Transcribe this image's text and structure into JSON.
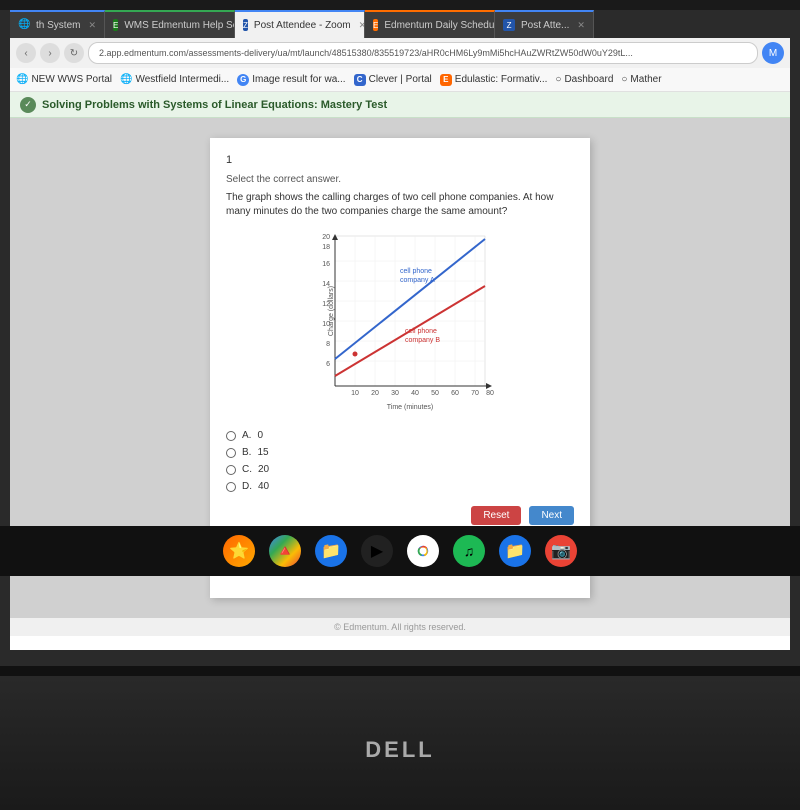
{
  "browser": {
    "tabs": [
      {
        "id": "tab1",
        "label": "th System",
        "active": false,
        "color": "blue"
      },
      {
        "id": "tab2",
        "label": "WMS Edmentum Help Session",
        "active": false,
        "color": "green"
      },
      {
        "id": "tab3",
        "label": "Post Attendee - Zoom",
        "active": true,
        "color": "blue"
      },
      {
        "id": "tab4",
        "label": "Edmentum Daily Schedule - S",
        "active": false,
        "color": "orange"
      },
      {
        "id": "tab5",
        "label": "Post Atte...",
        "active": false,
        "color": "blue"
      }
    ],
    "address": "2.app.edmentum.com/assessments-delivery/ua/mt/launch/48515380/835519723/aHR0cHM6Ly9mMi5hcHAuZWRtZW50dW0uY29tL...",
    "bookmarks": [
      {
        "label": "NEW WWS Portal",
        "icon": "🌐"
      },
      {
        "label": "Westfield Intermedi...",
        "icon": "🌐"
      },
      {
        "label": "Image result for wa...",
        "icon": "G"
      },
      {
        "label": "Clever | Portal",
        "icon": "C"
      },
      {
        "label": "Edulastic: Formativ...",
        "icon": "E"
      },
      {
        "label": "Dashboard",
        "icon": "○"
      },
      {
        "label": "Mather",
        "icon": "○"
      }
    ]
  },
  "page": {
    "header": "Solving Problems with Systems of Linear Equations: Mastery Test",
    "question_number": "1",
    "instruction": "Select the correct answer.",
    "question_text": "The graph shows the calling charges of two cell phone companies. At how many minutes do the two companies charge the same amount?",
    "graph": {
      "x_label": "Time (minutes)",
      "y_label": "Charge (dollars)",
      "x_ticks": [
        "10",
        "20",
        "30",
        "40",
        "50",
        "60",
        "70",
        "80"
      ],
      "y_ticks": [
        "6",
        "8",
        "10",
        "12",
        "14",
        "16",
        "18",
        "20"
      ],
      "line_a_label": "cell phone company A",
      "line_b_label": "cell phone company B"
    },
    "answers": [
      {
        "id": "A",
        "label": "A.",
        "value": "0"
      },
      {
        "id": "B",
        "label": "B.",
        "value": "15"
      },
      {
        "id": "C",
        "label": "C.",
        "value": "20"
      },
      {
        "id": "D",
        "label": "D.",
        "value": "40"
      }
    ],
    "buttons": {
      "reset": "Reset",
      "next": "Next"
    },
    "footer": "© Edmentum. All rights reserved."
  },
  "taskbar": {
    "icons": [
      "⭐",
      "🔺",
      "📁",
      "▶",
      "🌐",
      "🎵",
      "📁",
      "📷"
    ]
  },
  "laptop_brand": "DELL"
}
